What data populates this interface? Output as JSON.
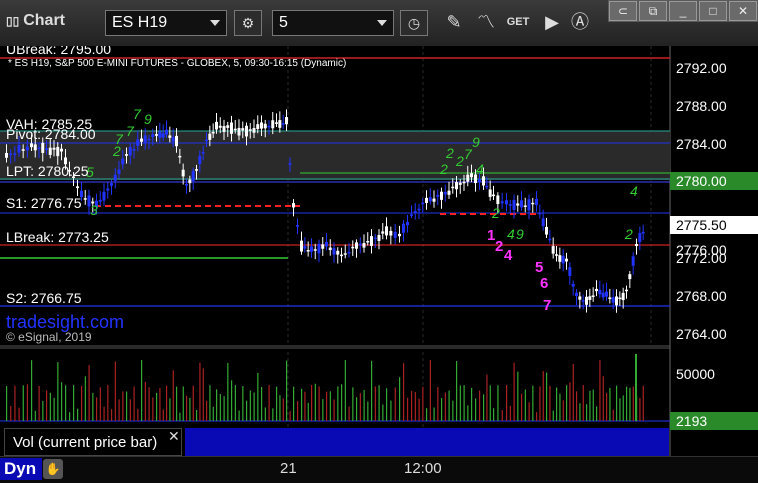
{
  "toolbar": {
    "app_label": "Chart",
    "symbol_value": "ES H19",
    "interval_value": "5"
  },
  "chart": {
    "description": "* ES H19, S&P 500 E-MINI FUTURES - GLOBEX, 5, 09:30-16:15 (Dynamic)",
    "price_axis": [
      "2792.00",
      "2788.00",
      "2784.00",
      "2780.00",
      "2776.00",
      "2772.00",
      "2768.00",
      "2764.00"
    ],
    "current_price": "2780.00",
    "last_price": "2775.50",
    "levels": {
      "ubreak": "UBreak: 2795.00",
      "vah": "VAH: 2785.25",
      "pivot": "Pivot: 2784.00",
      "lpt": "LPT: 2780.25",
      "s1": "S1: 2776.75",
      "lbreak": "LBreak: 2773.25",
      "s2": "S2: 2766.75"
    },
    "watermark": "tradesight.com",
    "copyright": "© eSignal, 2019",
    "time_labels": [
      "21",
      "12:00"
    ],
    "annotations_magenta": [
      "1",
      "2",
      "4",
      "5",
      "6",
      "7"
    ],
    "colors": {
      "up_candle": "#ffffff",
      "down_candle": "#2233ff",
      "level_red": "#cc2222",
      "level_teal": "#2aa89a",
      "level_green": "#33cc33",
      "tpo_green": "#33cc33",
      "magenta": "#ff33ff",
      "price_box": "#2a8a2a"
    }
  },
  "volume": {
    "label": "Vol (current price bar)",
    "axis_label": "50000",
    "current_value": "2193"
  },
  "bottom": {
    "dyn_label": "Dyn"
  }
}
